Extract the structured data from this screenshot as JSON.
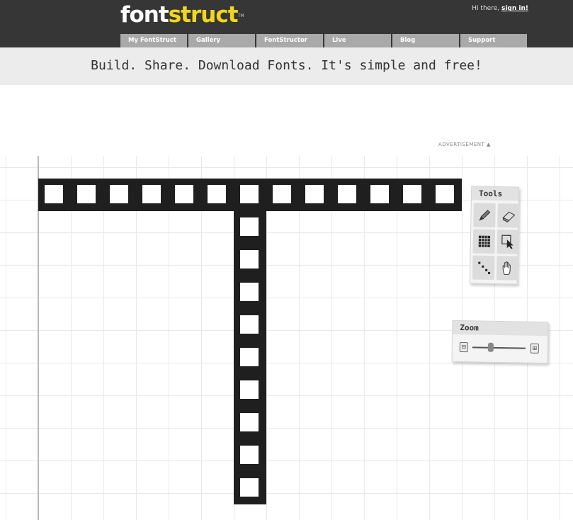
{
  "header": {
    "logo_part1": "font",
    "logo_part2": "struct",
    "logo_tm": "TM",
    "greeting": "Hi there, ",
    "sign_in": "sign in!"
  },
  "nav": {
    "tabs": [
      "My FontStruct",
      "Gallery",
      "FontStructor",
      "Live",
      "Blog",
      "Support"
    ]
  },
  "tagline": "Build. Share. Download Fonts. It's simple and free!",
  "ad_label": "ADVERTISEMENT ▲",
  "tools_panel": {
    "title": "Tools",
    "tools": [
      "pencil-icon",
      "eraser-icon",
      "fill-grid-icon",
      "select-arrow-icon",
      "line-icon",
      "hand-icon"
    ]
  },
  "zoom_panel": {
    "title": "Zoom",
    "out_glyph": "⊟",
    "in_glyph": "⊞",
    "level": 0.35
  },
  "colors": {
    "header_bg": "#363636",
    "logo_accent": "#f2d61c",
    "tab_bg": "#a9a9a9",
    "brick": "#1f1f1f"
  }
}
